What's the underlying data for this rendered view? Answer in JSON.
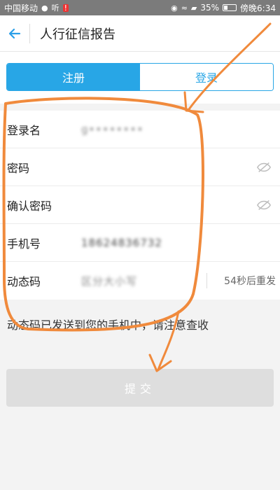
{
  "status_bar": {
    "carrier": "中国移动",
    "battery": "35%",
    "time": "傍晚6:34"
  },
  "header": {
    "title": "人行征信报告"
  },
  "tabs": [
    {
      "label": "注册"
    },
    {
      "label": "登录"
    }
  ],
  "form": {
    "rows": [
      {
        "label": "登录名",
        "value": "g••••••••"
      },
      {
        "label": "密码",
        "value": ""
      },
      {
        "label": "确认密码",
        "value": ""
      },
      {
        "label": "手机号",
        "value": "18624836732"
      },
      {
        "label": "动态码",
        "value": "区分大小写"
      }
    ],
    "resend_label": "54秒后重发"
  },
  "notice": "动态码已发送到您的手机中，请注意查收",
  "submit_label": "提交",
  "colors": {
    "accent": "#28a6e6",
    "annotation": "#f08a3c"
  }
}
